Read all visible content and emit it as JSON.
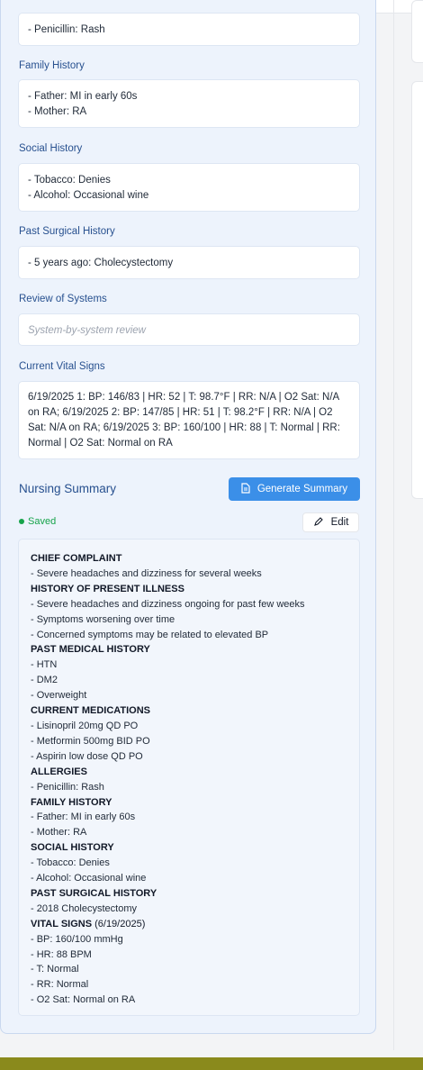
{
  "allergies_top": {
    "value_lines": [
      "- Penicillin: Rash"
    ]
  },
  "family_history": {
    "label": "Family History",
    "value_lines": [
      "- Father: MI in early 60s",
      "- Mother: RA"
    ]
  },
  "social_history": {
    "label": "Social History",
    "value_lines": [
      "- Tobacco: Denies",
      "- Alcohol: Occasional wine"
    ]
  },
  "past_surgical_history": {
    "label": "Past Surgical History",
    "value_lines": [
      "- 5 years ago: Cholecystectomy"
    ]
  },
  "review_of_systems": {
    "label": "Review of Systems",
    "placeholder": "System-by-system review"
  },
  "current_vital_signs": {
    "label": "Current Vital Signs",
    "value_lines": [
      "6/19/2025 1: BP: 146/83 | HR: 52 | T: 98.7°F | RR: N/A | O2 Sat: N/A",
      "on RA; 6/19/2025 2: BP: 147/85 | HR: 51 | T: 98.2°F | RR: N/A | O2",
      "Sat: N/A on RA; 6/19/2025 3: BP: 160/100 | HR: 88 | T: Normal | RR:",
      "Normal | O2 Sat: Normal on RA"
    ]
  },
  "nursing_summary": {
    "title": "Nursing Summary",
    "generate_label": "Generate Summary",
    "saved_label": "Saved",
    "edit_label": "Edit",
    "lines": [
      {
        "text": "CHIEF COMPLAINT",
        "heading": true
      },
      {
        "text": "- Severe headaches and dizziness for several weeks"
      },
      {
        "text": "HISTORY OF PRESENT ILLNESS",
        "heading": true
      },
      {
        "text": "- Severe headaches and dizziness ongoing for past few weeks"
      },
      {
        "text": "- Symptoms worsening over time"
      },
      {
        "text": "- Concerned symptoms may be related to elevated BP"
      },
      {
        "text": "PAST MEDICAL HISTORY",
        "heading": true
      },
      {
        "text": "- HTN"
      },
      {
        "text": "- DM2"
      },
      {
        "text": "- Overweight"
      },
      {
        "text": "CURRENT MEDICATIONS",
        "heading": true
      },
      {
        "text": "- Lisinopril 20mg QD PO"
      },
      {
        "text": "- Metformin 500mg BID PO"
      },
      {
        "text": "- Aspirin low dose QD PO"
      },
      {
        "text": "ALLERGIES",
        "heading": true
      },
      {
        "text": "- Penicillin: Rash"
      },
      {
        "text": "FAMILY HISTORY",
        "heading": true
      },
      {
        "text": "- Father: MI in early 60s"
      },
      {
        "text": "- Mother: RA"
      },
      {
        "text": "SOCIAL HISTORY",
        "heading": true
      },
      {
        "text": "- Tobacco: Denies"
      },
      {
        "text": "- Alcohol: Occasional wine"
      },
      {
        "text": "PAST SURGICAL HISTORY",
        "heading": true
      },
      {
        "text": "- 2018 Cholecystectomy"
      },
      {
        "text": "VITAL SIGNS",
        "heading": true,
        "suffix": " (6/19/2025)"
      },
      {
        "text": "- BP: 160/100 mmHg"
      },
      {
        "text": "- HR: 88 BPM"
      },
      {
        "text": "- T: Normal"
      },
      {
        "text": "- RR: Normal"
      },
      {
        "text": "- O2 Sat: Normal on RA"
      }
    ]
  },
  "colors": {
    "accent": "#3b8fe8",
    "label": "#27508f",
    "saved": "#16a34a",
    "panel_bg": "#edf3fc"
  },
  "icons": {
    "generate": "document-icon",
    "edit": "pencil-icon",
    "saved": "status-dot-icon"
  }
}
